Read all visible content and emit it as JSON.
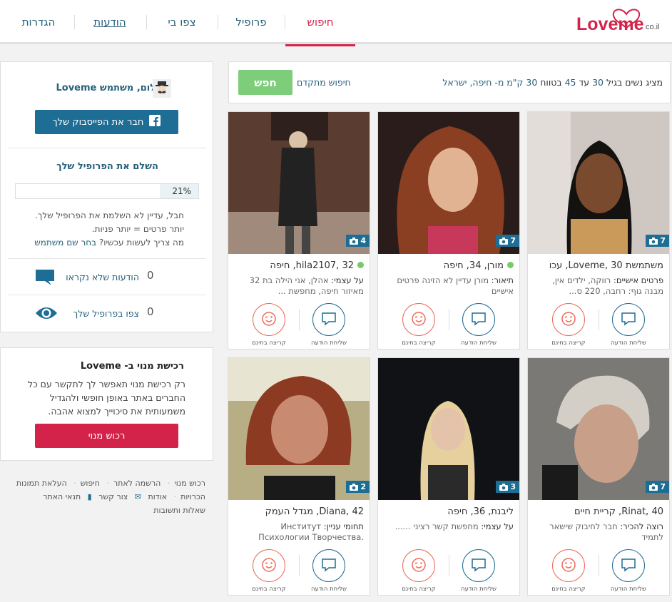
{
  "nav": {
    "logo_text": "Loveme",
    "logo_suffix": "co.il",
    "items": [
      {
        "label": "חיפוש",
        "active": true
      },
      {
        "label": "פרופיל"
      },
      {
        "label": "צפו בי"
      },
      {
        "label": "הודעות"
      },
      {
        "label": "הגדרות"
      }
    ]
  },
  "search": {
    "summary_parts": [
      "מציג נשים בגיל ",
      "30",
      " עד ",
      "45",
      " בטווח ",
      "30",
      " ק\"מ מ- חיפה, ישראל"
    ],
    "advanced_label": "חיפוש מתקדם",
    "button_label": "חפש"
  },
  "labels": {
    "send_message": "שליחת הודעה",
    "wink": "קריצה בחינם"
  },
  "cards": [
    {
      "name_line": "משתמשת Loveme, 30, עכו",
      "online": false,
      "desc_key": "פרטים אישיים:",
      "desc": "רווקה, ילדים אין, מבנה גוף: רחבה, 220 ס...",
      "photos": "7"
    },
    {
      "name_line": "מורן, 34, חיפה",
      "online": true,
      "desc_key": "תיאור:",
      "desc": "מורן עדיין לא הזינה פרטים אישיים",
      "photos": "7"
    },
    {
      "name_line": "hila2107, 32, חיפה",
      "online": true,
      "desc_key": "על עצמי:",
      "desc": "אהלן, אני הילה בת 32 מאיזור חיפה, מחפשת ...",
      "photos": "4"
    },
    {
      "name_line": "Rinat, 40, קריית חיים",
      "online": false,
      "desc_key": "רוצה להכיר:",
      "desc": "חבר לחיבוק שישאר לתמיד",
      "photos": "7"
    },
    {
      "name_line": "ליבנת, 36, חיפה",
      "online": false,
      "desc_key": "על עצמי:",
      "desc": "מחפשת קשר רציני ......",
      "photos": "3"
    },
    {
      "name_line": "Diana, 42, מגדל העמק",
      "online": false,
      "desc_key": "תחומי עניין:",
      "desc": "Институт Психологии Творчества. Нейрогра",
      "photos": "2"
    }
  ],
  "sidebar": {
    "hello": "שלום, משתמש Loveme",
    "facebook_button": "חבר את הפייסבוק שלך",
    "complete_title": "השלם את הפרופיל שלך",
    "progress_text": "21%",
    "progress_value": 0.21,
    "profile_text_1": "חבל, עדיין לא השלמת את הפרופיל שלך.",
    "profile_text_2": "יותר פרטים = יותר פניות.",
    "profile_text_3": "מה צריך לעשות עכשיו?",
    "profile_link": "בחר שם משתמש",
    "unread_label": "הודעות שלא נקראו",
    "unread_count": "0",
    "views_label": "צפו בפרופיל שלך",
    "views_count": "0"
  },
  "subscription": {
    "title": "רכישת מנוי ב- Loveme",
    "text": "רק רכישת מנוי תאפשר לך לתקשר עם כל החברים באתר באופן חופשי ולהגדיל משמעותית את סיכוייך למצוא אהבה.",
    "button": "רכוש מנוי"
  },
  "footer": {
    "links": [
      "רכוש מנוי",
      "הרשמה לאתר",
      "חיפוש",
      "העלאת תמונות",
      "הכרויות",
      "אודות",
      "צור קשר",
      "תנאי האתר",
      "שאלות ותשובות"
    ]
  }
}
